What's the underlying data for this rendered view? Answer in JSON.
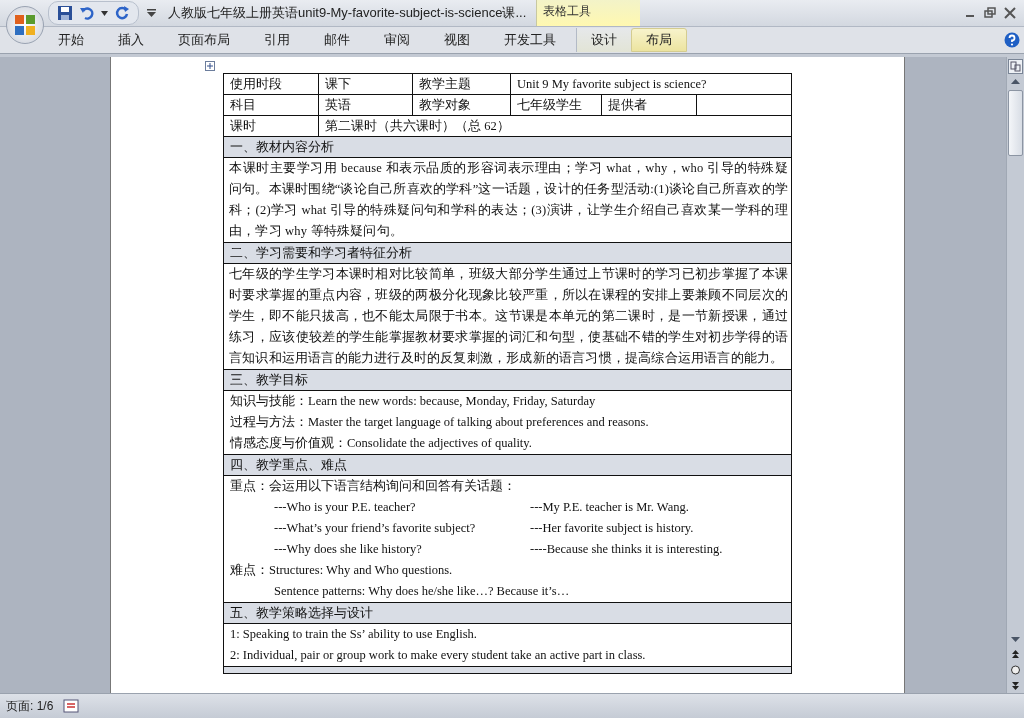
{
  "window": {
    "title": "人教版七年级上册英语unit9-My-favorite-subject-is-science课...",
    "context_group": "表格工具"
  },
  "ribbon_tabs": [
    {
      "label": "开始",
      "selected": false,
      "contextual": false
    },
    {
      "label": "插入",
      "selected": false,
      "contextual": false
    },
    {
      "label": "页面布局",
      "selected": false,
      "contextual": false
    },
    {
      "label": "引用",
      "selected": false,
      "contextual": false
    },
    {
      "label": "邮件",
      "selected": false,
      "contextual": false
    },
    {
      "label": "审阅",
      "selected": false,
      "contextual": false
    },
    {
      "label": "视图",
      "selected": false,
      "contextual": false
    },
    {
      "label": "开发工具",
      "selected": false,
      "contextual": false
    },
    {
      "label": "设计",
      "selected": false,
      "contextual": true
    },
    {
      "label": "布局",
      "selected": true,
      "contextual": true
    }
  ],
  "info_table": {
    "row_1": [
      "使用时段",
      "课下",
      "教学主题",
      "Unit 9 My favorite subject is science?"
    ],
    "row_2": [
      "科目",
      "英语",
      "教学对象",
      "七年级学生",
      "提供者"
    ],
    "row_3": [
      "课时",
      "第二课时（共六课时）（总 62）"
    ]
  },
  "sections": [
    {
      "heading": "一、教材内容分析",
      "kind": "paragraph",
      "text": "本课时主要学习用 because 和表示品质的形容词表示理由；学习 what，why，who 引导的特殊疑问句。本课时围绕“谈论自己所喜欢的学科”这一话题，设计的任务型活动:(1)谈论自己所喜欢的学科；(2)学习 what 引导的特殊疑问句和学科的表达；(3)演讲，让学生介绍自己喜欢某一学科的理由，学习 why 等特殊疑问句。"
    },
    {
      "heading": "二、学习需要和学习者特征分析",
      "kind": "paragraph",
      "text": "七年级的学生学习本课时相对比较简单，班级大部分学生通过上节课时的学习已初步掌握了本课时要求掌握的重点内容，班级的两极分化现象比较严重，所以在课程的安排上要兼顾不同层次的学生，即不能只拔高，也不能太局限于书本。这节课是本单元的第二课时，是一节新授课，通过练习，应该使较差的学生能掌握教材要求掌握的词汇和句型，使基础不错的学生对初步学得的语言知识和运用语言的能力进行及时的反复刺激，形成新的语言习惯，提高综合运用语言的能力。"
    },
    {
      "heading": "三、教学目标",
      "kind": "lines",
      "lines": [
        {
          "kind": "labeled",
          "label": "知识与技能：",
          "text": "Learn the new words: because,  Monday, Friday, Saturday"
        },
        {
          "kind": "labeled",
          "label": "过程与方法：",
          "text": "Master the target language of talking about preferences and reasons."
        },
        {
          "kind": "labeled",
          "label": "情感态度与价值观：",
          "text": "Consolidate the adjectives of quality."
        }
      ]
    },
    {
      "heading": "四、教学重点、难点",
      "kind": "lines",
      "lines": [
        {
          "kind": "labeled",
          "label": "重点：",
          "text": "会运用以下语言结构询问和回答有关话题："
        },
        {
          "kind": "qa",
          "question": "---Who is your P.E. teacher?",
          "answer": "---My P.E. teacher is Mr. Wang."
        },
        {
          "kind": "qa",
          "question": "---What’s your friend’s favorite subject?",
          "answer": "---Her favorite subject is history."
        },
        {
          "kind": "qa",
          "question": "---Why does she like history?",
          "answer": "----Because she thinks it is interesting."
        },
        {
          "kind": "labeled",
          "label": "难点：",
          "text": "Structures: Why and Who questions."
        },
        {
          "kind": "indented",
          "text": "Sentence patterns: Why does he/she  like…? Because  it’s…"
        }
      ]
    },
    {
      "heading": "五、教学策略选择与设计",
      "kind": "lines",
      "lines": [
        {
          "kind": "plain",
          "text": "1: Speaking to train the Ss’ ability to use English."
        },
        {
          "kind": "plain",
          "text": "2: Individual, pair or group work to make every student take an active part in class."
        }
      ]
    }
  ],
  "status_bar": {
    "page": "页面: 1/6"
  }
}
